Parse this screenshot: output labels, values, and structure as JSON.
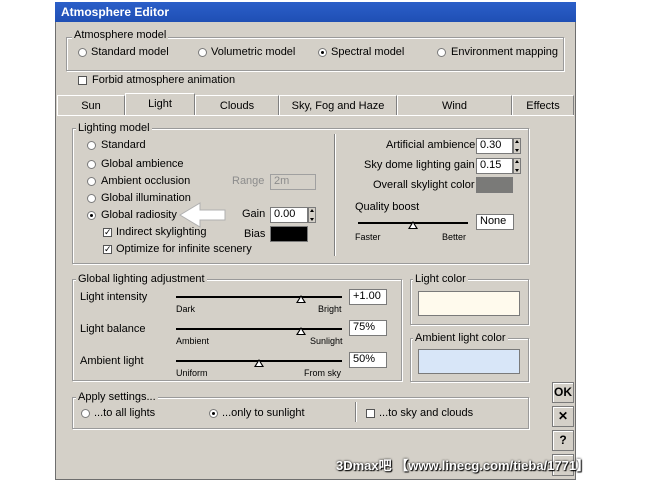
{
  "window": {
    "title": "Atmosphere Editor"
  },
  "atmosphere_model": {
    "label": "Atmosphere model",
    "options": [
      "Standard model",
      "Volumetric model",
      "Spectral model",
      "Environment mapping"
    ],
    "selected": "Spectral model"
  },
  "forbid_animation": {
    "label": "Forbid atmosphere animation",
    "checked": false
  },
  "tabs": [
    "Sun",
    "Light",
    "Clouds",
    "Sky, Fog and Haze",
    "Wind",
    "Effects"
  ],
  "active_tab": "Light",
  "lighting_model": {
    "label": "Lighting model",
    "options": [
      "Standard",
      "Global ambience",
      "Ambient occlusion",
      "Global illumination",
      "Global radiosity"
    ],
    "selected": "Global radiosity",
    "range_label": "Range",
    "range_value": "2m",
    "gain_label": "Gain",
    "gain_value": "0.00",
    "bias_label": "Bias",
    "bias_color": "#000000",
    "indirect_skylighting": {
      "label": "Indirect skylighting",
      "checked": true
    },
    "optimize_infinite": {
      "label": "Optimize for infinite scenery",
      "checked": true
    }
  },
  "right_panel": {
    "artificial_ambience_label": "Artificial ambience",
    "artificial_ambience_value": "0.30",
    "sky_dome_label": "Sky dome lighting gain",
    "sky_dome_value": "0.15",
    "skylight_color_label": "Overall skylight color",
    "skylight_color": "#7a7a78",
    "quality_boost_label": "Quality boost",
    "quality_boost_value": "None",
    "quality_boost_level": 0.5,
    "faster_label": "Faster",
    "better_label": "Better"
  },
  "global_adjust": {
    "label": "Global lighting adjustment",
    "sliders": [
      {
        "label": "Light intensity",
        "value": "+1.00",
        "min_label": "Dark",
        "max_label": "Bright",
        "level": 0.75
      },
      {
        "label": "Light balance",
        "value": "75%",
        "min_label": "Ambient",
        "max_label": "Sunlight",
        "level": 0.75
      },
      {
        "label": "Ambient light",
        "value": "50%",
        "min_label": "Uniform",
        "max_label": "From sky",
        "level": 0.5
      }
    ]
  },
  "light_color": {
    "label": "Light color",
    "color": "#fffaed"
  },
  "ambient_light_color": {
    "label": "Ambient light color",
    "color": "#d8e6f8"
  },
  "apply_settings": {
    "label": "Apply settings...",
    "to_all": "...to all lights",
    "only_sun": "...only to sunlight",
    "selected": "...only to sunlight",
    "sky_clouds": {
      "label": "...to sky and clouds",
      "checked": false
    }
  },
  "side_buttons": {
    "ok": "OK",
    "cancel": "✕",
    "help": "?"
  },
  "watermark": "3Dmax吧 【www.linecg.com/tieba/1771】"
}
